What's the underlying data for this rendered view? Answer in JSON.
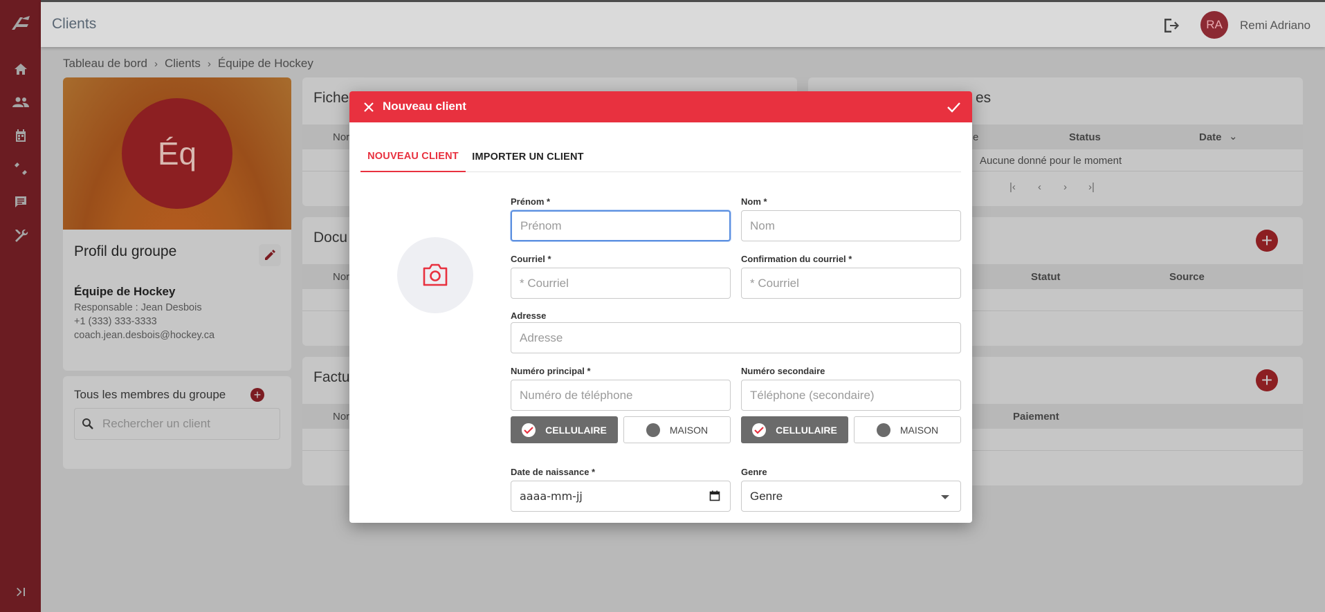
{
  "app": {
    "title": "Clients"
  },
  "user": {
    "initials": "RA",
    "name": "Remi Adriano"
  },
  "breadcrumb": {
    "items": [
      "Tableau de bord",
      "Clients",
      "Équipe de Hockey"
    ]
  },
  "profile": {
    "initials": "Éq",
    "section_title": "Profil du groupe",
    "group_name": "Équipe de Hockey",
    "responsible": "Responsable : Jean Desbois",
    "phone": "+1 (333) 333-3333",
    "email": "coach.jean.desbois@hockey.ca"
  },
  "members": {
    "title": "Tous les membres du groupe",
    "search_placeholder": "Rechercher un client"
  },
  "fiche": {
    "title": "Fiche",
    "col_name": "Nor"
  },
  "right_panel": {
    "title_tail": "es",
    "col_partial": "e",
    "col_status": "Status",
    "col_date": "Date",
    "empty": "Aucune donné pour le moment"
  },
  "documents": {
    "title": "Docu",
    "col_name": "Nor",
    "col_status": "Statut",
    "col_source": "Source"
  },
  "factures": {
    "title": "Factu",
    "col_name": "Nor",
    "col_payment": "Paiement"
  },
  "modal": {
    "title": "Nouveau client",
    "tabs": [
      "NOUVEAU CLIENT",
      "IMPORTER UN CLIENT"
    ],
    "fields": {
      "first_name": {
        "label": "Prénom *",
        "placeholder": "Prénom"
      },
      "last_name": {
        "label": "Nom *",
        "placeholder": "Nom"
      },
      "email": {
        "label": "Courriel *",
        "placeholder": "* Courriel"
      },
      "email_confirm": {
        "label": "Confirmation du courriel *",
        "placeholder": "* Courriel"
      },
      "address": {
        "label": "Adresse",
        "placeholder": "Adresse"
      },
      "phone_main": {
        "label": "Numéro principal *",
        "placeholder": "Numéro de téléphone"
      },
      "phone_secondary": {
        "label": "Numéro secondaire",
        "placeholder": "Téléphone (secondaire)"
      },
      "birthdate": {
        "label": "Date de naissance *",
        "placeholder": "aaaa-mm-jj"
      },
      "gender": {
        "label": "Genre",
        "value": "Genre"
      }
    },
    "phone_types": {
      "mobile": "CELLULAIRE",
      "home": "MAISON"
    }
  },
  "colors": {
    "accent": "#e8313f",
    "sidebar": "#6b1c22",
    "toggle_on": "#6b6b6b"
  },
  "icons": [
    "logo-icon",
    "home-icon",
    "people-icon",
    "calendar-icon",
    "exercise-icon",
    "chat-icon",
    "tools-icon",
    "expand-icon",
    "logout-icon",
    "edit-icon",
    "search-icon",
    "camera-icon",
    "close-icon",
    "check-icon",
    "calendar-input-icon",
    "dropdown-arrow-icon"
  ]
}
